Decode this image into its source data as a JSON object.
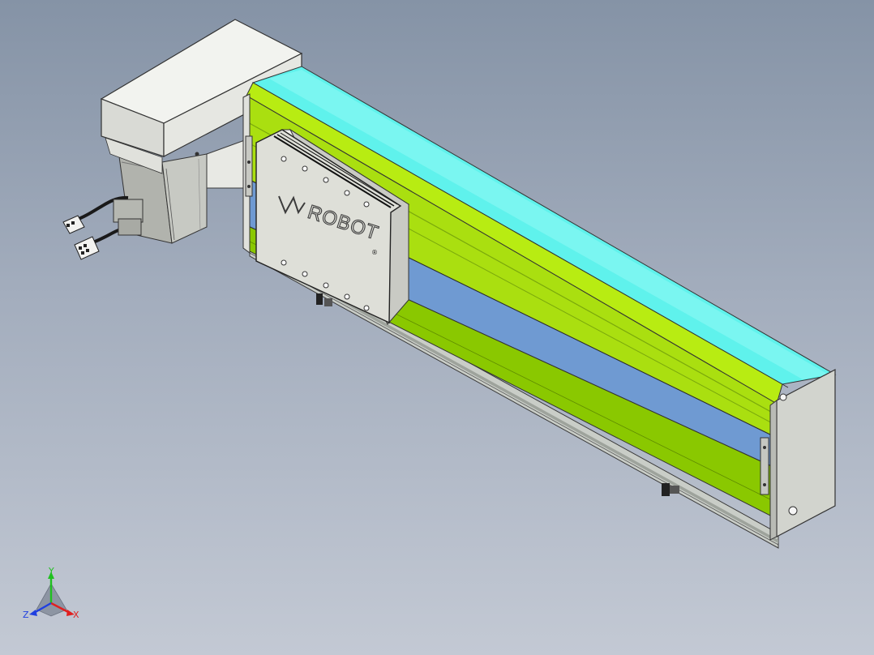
{
  "model": {
    "brand_text": "ROBOT",
    "registered_mark": "®",
    "colors": {
      "background_top": "#8593a6",
      "background_bottom": "#c3c9d4",
      "rail_top_cyan": "#5ff2ec",
      "rail_lime": "#aadf10",
      "rail_green": "#8ac800",
      "rail_stripe": "#6f9ad2",
      "housing_grey": "#e6e8e3",
      "carriage_face": "#dedfd8"
    }
  },
  "triad": {
    "x_label": "X",
    "y_label": "Y",
    "z_label": "Z",
    "x_color": "#e02020",
    "y_color": "#20c020",
    "z_color": "#2040e0"
  }
}
